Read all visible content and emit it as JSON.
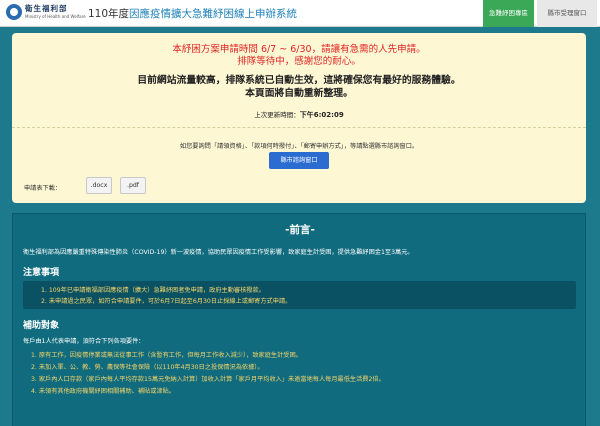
{
  "header": {
    "logo_cn": "衛生福利部",
    "logo_en": "Ministry of Health and Welfare",
    "title_prefix": "110年度",
    "title_accent": "因應疫情擴大急難紓困線上申辦系統",
    "tab_active": "急難紓困專區",
    "tab_other": "縣市受理窗口"
  },
  "notice": {
    "red_line_1": "本紓困方案申請時間 6/7 ~ 6/30，請讓有急需的人先申請。",
    "red_line_2": "排隊等待中，感謝您的耐心。",
    "dark_line_1": "目前網站流量較高，排隊系統已自動生效，這將確保您有最好的服務體驗。",
    "dark_line_2": "本頁面將自動重新整理。",
    "update_label": "上次更新時間：",
    "update_time": "下午6:02:09",
    "query_text": "如您要詢問「請領資格」、「款項何時撥付」、「郵寄申辦方式」，等請點選縣市諮詢窗口。",
    "query_button": "縣市諮詢窗口",
    "download_label": "申請表下載：",
    "download_docx": ".docx",
    "download_pdf": ".pdf"
  },
  "panel": {
    "preface_title": "-前言-",
    "intro": "衛生福利部為因應嚴重特殊傳染性肺炎（COVID-19）新一波疫情，協助民眾因疫情工作受影響，致家庭生計受困，提供急難紓困金1至3萬元。",
    "notes_title": "注意事項",
    "notes": [
      "1. 109年已申請衛福部因應疫情（擴大）急難紓困者免申請，政府主動審核撥款。",
      "2. 未申請過之民眾，如符合申請要件，可於6月7日起至6月30日止採線上或郵寄方式申請。"
    ],
    "target_title": "補助對象",
    "target_intro": "每戶由1人代表申請，須符合下列各項要件：",
    "conditions": [
      "1. 原有工作，因疫情停業或無法從事工作（含暫有工作，但每月工作收入減少），致家庭生計受困。",
      "2. 未加入軍、公、教、勞、農保等社會保險（以110年4月30日之投保情況為依據）。",
      "3. 家戶內人口存款（家戶內每人平均存款15萬元免納入計算）加收入計算「家戶月平均收入」未逾當地每人每月最低生活費2倍。",
      "4. 未領有其他政府機關紓困相關補助、補貼或津貼。"
    ]
  }
}
